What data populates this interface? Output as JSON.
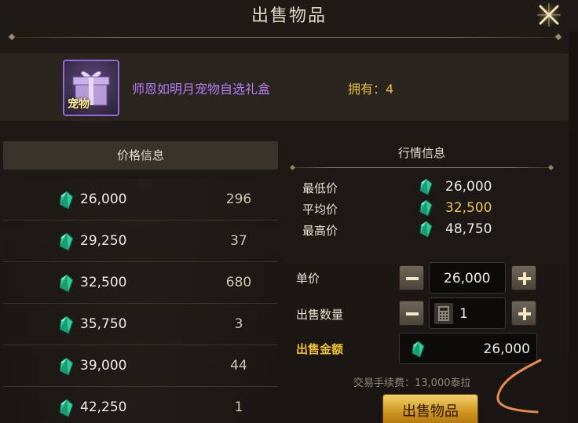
{
  "dialog": {
    "title": "出售物品",
    "close_icon": "close-x-icon"
  },
  "item": {
    "name": "师恩如明月宠物自选礼盒",
    "tag": "宠物",
    "owned": "拥有：4",
    "name_color": "#b57af0"
  },
  "price_info": {
    "header": "价格信息",
    "rows": [
      {
        "price": "26,000",
        "qty": "296"
      },
      {
        "price": "29,250",
        "qty": "37"
      },
      {
        "price": "32,500",
        "qty": "680"
      },
      {
        "price": "35,750",
        "qty": "3"
      },
      {
        "price": "39,000",
        "qty": "44"
      },
      {
        "price": "42,250",
        "qty": "1"
      }
    ]
  },
  "market": {
    "header": "行情信息",
    "min_label": "最低价",
    "min_value": "26,000",
    "avg_label": "平均价",
    "avg_value": "32,500",
    "max_label": "最高价",
    "max_value": "48,750"
  },
  "form": {
    "unit_price_label": "单价",
    "unit_price_value": "26,000",
    "quantity_label": "出售数量",
    "quantity_value": "1",
    "total_label": "出售金额",
    "total_value": "26,000",
    "fee_text": "交易手续费：13,000泰拉",
    "sell_button": "出售物品"
  },
  "colors": {
    "accent_gold": "#f0c130",
    "gem": "#2fcf9c"
  }
}
